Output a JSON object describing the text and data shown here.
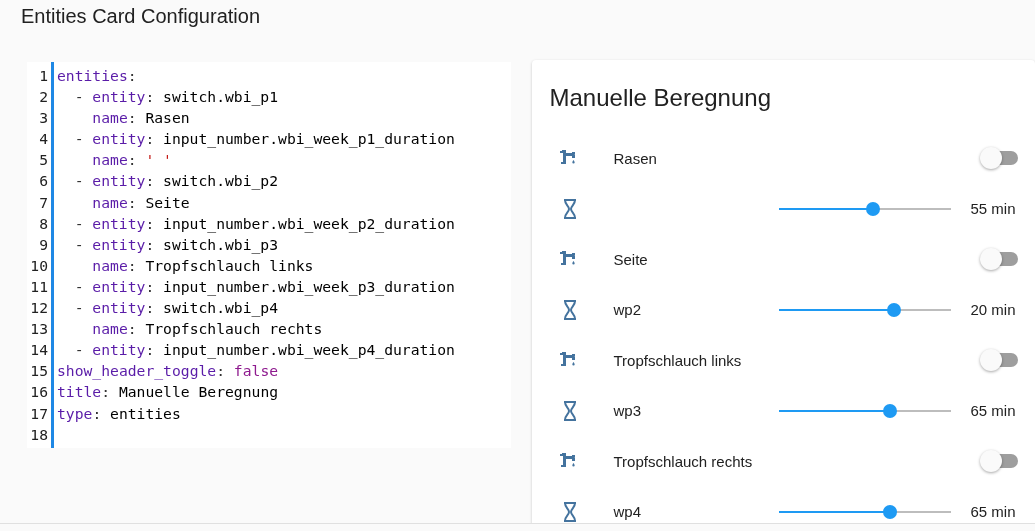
{
  "page_title": "Entities Card Configuration",
  "editor": {
    "lines": [
      {
        "number": "1",
        "kind": "top",
        "tokens": [
          {
            "kind": "key",
            "text": "entities"
          },
          {
            "kind": "punct",
            "text": ":"
          }
        ]
      },
      {
        "number": "2",
        "kind": "item",
        "tokens": [
          {
            "kind": "dash",
            "text": "-"
          },
          {
            "kind": "key",
            "text": "entity"
          },
          {
            "kind": "punct",
            "text": ": "
          },
          {
            "kind": "value",
            "text": "switch.wbi_p1"
          }
        ]
      },
      {
        "number": "3",
        "kind": "field",
        "tokens": [
          {
            "kind": "key",
            "text": "name"
          },
          {
            "kind": "punct",
            "text": ": "
          },
          {
            "kind": "value",
            "text": "Rasen"
          }
        ]
      },
      {
        "number": "4",
        "kind": "item",
        "tokens": [
          {
            "kind": "dash",
            "text": "-"
          },
          {
            "kind": "key",
            "text": "entity"
          },
          {
            "kind": "punct",
            "text": ": "
          },
          {
            "kind": "value",
            "text": "input_number.wbi_week_p1_duration"
          }
        ]
      },
      {
        "number": "5",
        "kind": "field",
        "tokens": [
          {
            "kind": "key",
            "text": "name"
          },
          {
            "kind": "punct",
            "text": ": "
          },
          {
            "kind": "string",
            "text": "' '"
          }
        ]
      },
      {
        "number": "6",
        "kind": "item",
        "tokens": [
          {
            "kind": "dash",
            "text": "-"
          },
          {
            "kind": "key",
            "text": "entity"
          },
          {
            "kind": "punct",
            "text": ": "
          },
          {
            "kind": "value",
            "text": "switch.wbi_p2"
          }
        ]
      },
      {
        "number": "7",
        "kind": "field",
        "tokens": [
          {
            "kind": "key",
            "text": "name"
          },
          {
            "kind": "punct",
            "text": ": "
          },
          {
            "kind": "value",
            "text": "Seite"
          }
        ]
      },
      {
        "number": "8",
        "kind": "item",
        "tokens": [
          {
            "kind": "dash",
            "text": "-"
          },
          {
            "kind": "key",
            "text": "entity"
          },
          {
            "kind": "punct",
            "text": ": "
          },
          {
            "kind": "value",
            "text": "input_number.wbi_week_p2_duration"
          }
        ]
      },
      {
        "number": "9",
        "kind": "item",
        "tokens": [
          {
            "kind": "dash",
            "text": "-"
          },
          {
            "kind": "key",
            "text": "entity"
          },
          {
            "kind": "punct",
            "text": ": "
          },
          {
            "kind": "value",
            "text": "switch.wbi_p3"
          }
        ]
      },
      {
        "number": "10",
        "kind": "field",
        "tokens": [
          {
            "kind": "key",
            "text": "name"
          },
          {
            "kind": "punct",
            "text": ": "
          },
          {
            "kind": "value",
            "text": "Tropfschlauch links"
          }
        ]
      },
      {
        "number": "11",
        "kind": "item",
        "tokens": [
          {
            "kind": "dash",
            "text": "-"
          },
          {
            "kind": "key",
            "text": "entity"
          },
          {
            "kind": "punct",
            "text": ": "
          },
          {
            "kind": "value",
            "text": "input_number.wbi_week_p3_duration"
          }
        ]
      },
      {
        "number": "12",
        "kind": "item",
        "tokens": [
          {
            "kind": "dash",
            "text": "-"
          },
          {
            "kind": "key",
            "text": "entity"
          },
          {
            "kind": "punct",
            "text": ": "
          },
          {
            "kind": "value",
            "text": "switch.wbi_p4"
          }
        ]
      },
      {
        "number": "13",
        "kind": "field",
        "tokens": [
          {
            "kind": "key",
            "text": "name"
          },
          {
            "kind": "punct",
            "text": ": "
          },
          {
            "kind": "value",
            "text": "Tropfschlauch rechts"
          }
        ]
      },
      {
        "number": "14",
        "kind": "item",
        "tokens": [
          {
            "kind": "dash",
            "text": "-"
          },
          {
            "kind": "key",
            "text": "entity"
          },
          {
            "kind": "punct",
            "text": ": "
          },
          {
            "kind": "value",
            "text": "input_number.wbi_week_p4_duration"
          }
        ]
      },
      {
        "number": "15",
        "kind": "top",
        "tokens": [
          {
            "kind": "key",
            "text": "show_header_toggle"
          },
          {
            "kind": "punct",
            "text": ": "
          },
          {
            "kind": "keyword",
            "text": "false"
          }
        ]
      },
      {
        "number": "16",
        "kind": "top",
        "tokens": [
          {
            "kind": "key",
            "text": "title"
          },
          {
            "kind": "punct",
            "text": ": "
          },
          {
            "kind": "value",
            "text": "Manuelle Beregnung"
          }
        ]
      },
      {
        "number": "17",
        "kind": "top",
        "tokens": [
          {
            "kind": "key",
            "text": "type"
          },
          {
            "kind": "punct",
            "text": ": "
          },
          {
            "kind": "value",
            "text": "entities"
          }
        ]
      },
      {
        "number": "18",
        "kind": "top"
      }
    ]
  },
  "card": {
    "title": "Manuelle Beregnung",
    "rows": [
      {
        "kind": "switch",
        "name": "Rasen",
        "on": false
      },
      {
        "kind": "slider",
        "level": 0.55,
        "value": "55 min"
      },
      {
        "kind": "switch",
        "name": "Seite",
        "on": false
      },
      {
        "kind": "slider",
        "name": "wp2",
        "level": 0.67,
        "value": "20 min"
      },
      {
        "kind": "switch",
        "name": "Tropfschlauch links",
        "on": false
      },
      {
        "kind": "slider",
        "name": "wp3",
        "level": 0.65,
        "value": "65 min"
      },
      {
        "kind": "switch",
        "name": "Tropfschlauch rechts",
        "on": false
      },
      {
        "kind": "slider",
        "name": "wp4",
        "level": 0.65,
        "value": "65 min"
      }
    ]
  }
}
